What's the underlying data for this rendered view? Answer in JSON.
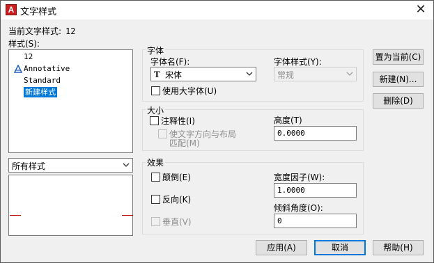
{
  "window": {
    "app_icon_glyph": "A",
    "title": "文字样式",
    "close_glyph": "✕",
    "accent": "#0078d7"
  },
  "current_style": {
    "label": "当前文字样式:",
    "value": "12"
  },
  "styles": {
    "label": "样式(S):",
    "items": [
      {
        "label": "12",
        "icon": "none"
      },
      {
        "label": "Annotative",
        "icon": "annotative-icon"
      },
      {
        "label": "Standard",
        "icon": "none"
      },
      {
        "label": "新建样式",
        "icon": "none",
        "selected": true
      }
    ]
  },
  "filter": {
    "value": "所有样式"
  },
  "font_group": {
    "title": "字体",
    "font_name_label": "字体名(F):",
    "font_name_value": "宋体",
    "font_icon_glyph": "T",
    "font_style_label": "字体样式(Y):",
    "font_style_value": "常规",
    "big_font_label": "使用大字体(U)",
    "big_font_checked": false
  },
  "size_group": {
    "title": "大小",
    "annotative_label": "注释性(I)",
    "annotative_checked": false,
    "match_orientation_line1": "使文字方向与布局",
    "match_orientation_line2": "匹配(M)",
    "height_label": "高度(T)",
    "height_value": "0.0000"
  },
  "effects_group": {
    "title": "效果",
    "upside_down_label": "颠倒(E)",
    "backwards_label": "反向(K)",
    "vertical_label": "垂直(V)",
    "width_factor_label": "宽度因子(W):",
    "width_factor_value": "1.0000",
    "oblique_label": "倾斜角度(O):",
    "oblique_value": "0"
  },
  "buttons": {
    "set_current": "置为当前(C)",
    "new": "新建(N)...",
    "delete": "删除(D)",
    "apply": "应用(A)",
    "cancel": "取消",
    "help": "帮助(H)"
  },
  "preview": {
    "baseline_color": "#c00000"
  }
}
